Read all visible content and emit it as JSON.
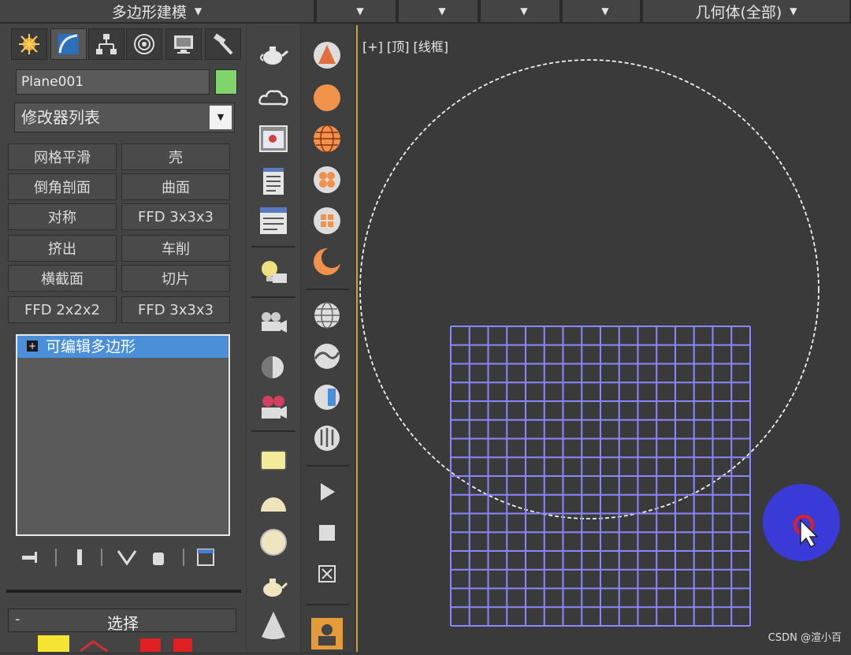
{
  "toolbar": {
    "mode_label": "多边形建模",
    "geometry_label": "几何体(全部)"
  },
  "panel": {
    "object_name": "Plane001",
    "object_color": "#7fd46a",
    "modifier_list_label": "修改器列表",
    "modifier_buttons": [
      "网格平滑",
      "壳",
      "倒角剖面",
      "曲面",
      "对称",
      "FFD 3x3x3",
      "挤出",
      "车削",
      "横截面",
      "切片",
      "FFD 2x2x2",
      "FFD 3x3x3"
    ],
    "stack_item": "可编辑多边形",
    "rollout_title": "选择"
  },
  "viewport": {
    "label": "[+] [顶] [线框]",
    "grid_rows": 16,
    "grid_cols": 16
  },
  "watermark": "CSDN @渲小百",
  "colors": {
    "accent_active_viewport": "#c8a23a",
    "selection_blue": "#4a8fd8",
    "wire_color": "#8a86ff"
  }
}
